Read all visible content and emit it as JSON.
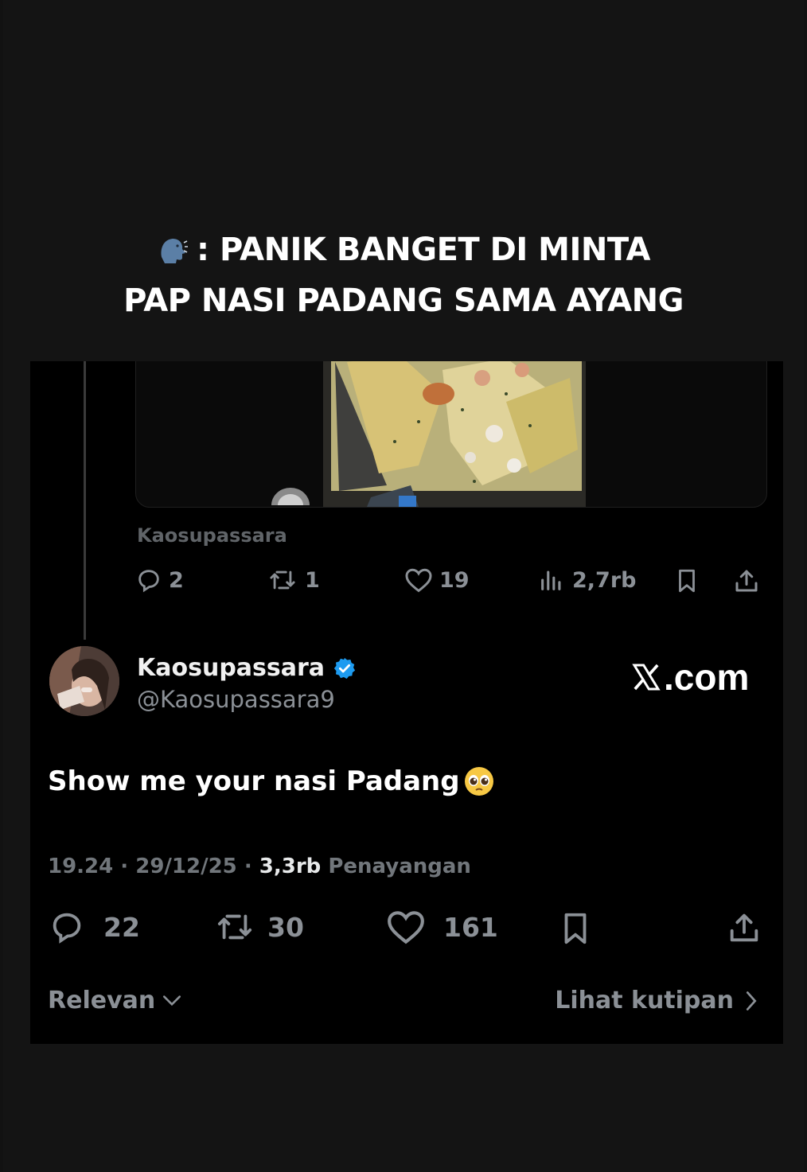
{
  "overlay": {
    "emoji": "speaking-head-emoji",
    "caption_line1": ": PANIK BANGET DI MINTA",
    "caption_line2": "PAP NASI PADANG SAMA AYANG"
  },
  "quoted_post": {
    "author": "Kaosupassara",
    "replies": "2",
    "reposts": "1",
    "likes": "19",
    "views": "2,7rb"
  },
  "post": {
    "display_name": "Kaosupassara",
    "verified": true,
    "handle": "@Kaosupassara9",
    "watermark": "X.com",
    "watermark_suffix": ".com",
    "text": "Show me your nasi Padang",
    "text_emoji": "pleading-face-emoji",
    "time": "19.24",
    "date": "29/12/25",
    "view_count": "3,3rb",
    "view_label": "Penayangan",
    "replies": "22",
    "reposts": "30",
    "likes": "161"
  },
  "footer": {
    "sort_label": "Relevan",
    "quotes_label": "Lihat kutipan"
  },
  "colors": {
    "background": "#141414",
    "card": "#000000",
    "muted": "#71767b",
    "verified": "#1d9bf0"
  }
}
